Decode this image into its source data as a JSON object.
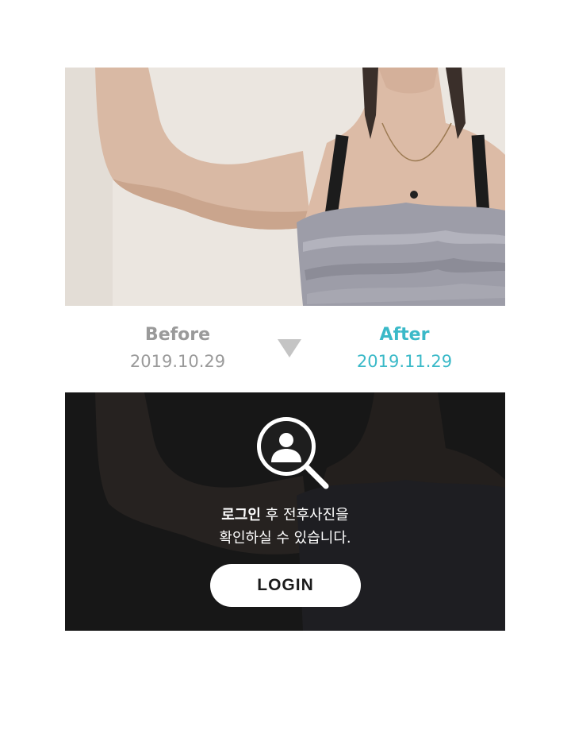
{
  "photo": {
    "alt_subject": "before-arm-photo"
  },
  "comparison": {
    "before": {
      "label": "Before",
      "date": "2019.10.29"
    },
    "after": {
      "label": "After",
      "date": "2019.11.29"
    },
    "arrow_icon": "triangle-down-icon"
  },
  "locked_panel": {
    "icon": "user-search-icon",
    "message_bold": "로그인",
    "message_line1_rest": " 후 전후사진을",
    "message_line2": "확인하실 수 있습니다.",
    "login_label": "LOGIN"
  },
  "colors": {
    "before_text": "#9a9a9a",
    "after_accent": "#3ab9c8",
    "overlay": "#1a1a1a",
    "arrow": "#c4c4c4"
  }
}
